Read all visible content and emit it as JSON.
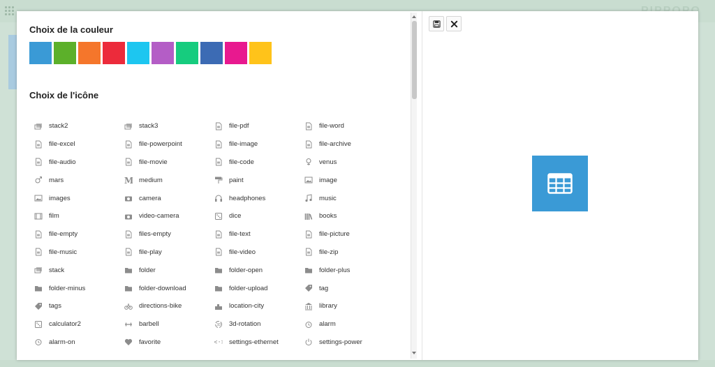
{
  "background": {
    "brand": "PIPPOPO"
  },
  "colors_section": {
    "title": "Choix de la couleur",
    "swatches": [
      "#3a9ad6",
      "#5cb02a",
      "#f5762b",
      "#ec2b3b",
      "#1dc6f0",
      "#b45dc6",
      "#16cc7e",
      "#3c6bb4",
      "#e8198f",
      "#ffc31a"
    ]
  },
  "icons_section": {
    "title": "Choix de l'icône",
    "rows": [
      [
        {
          "label": "stack2",
          "icon": "stack2-icon"
        },
        {
          "label": "stack3",
          "icon": "stack3-icon"
        },
        {
          "label": "file-pdf",
          "icon": "file-pdf-icon"
        },
        {
          "label": "file-word",
          "icon": "file-word-icon"
        }
      ],
      [
        {
          "label": "file-excel",
          "icon": "file-excel-icon"
        },
        {
          "label": "file-powerpoint",
          "icon": "file-powerpoint-icon"
        },
        {
          "label": "file-image",
          "icon": "file-image-icon"
        },
        {
          "label": "file-archive",
          "icon": "file-archive-icon"
        }
      ],
      [
        {
          "label": "file-audio",
          "icon": "file-audio-icon"
        },
        {
          "label": "file-movie",
          "icon": "file-movie-icon"
        },
        {
          "label": "file-code",
          "icon": "file-code-icon"
        },
        {
          "label": "venus",
          "icon": "venus-icon"
        }
      ],
      [
        {
          "label": "mars",
          "icon": "mars-icon"
        },
        {
          "label": "medium",
          "icon": "medium-icon"
        },
        {
          "label": "paint",
          "icon": "paint-icon"
        },
        {
          "label": "image",
          "icon": "image-icon"
        }
      ],
      [
        {
          "label": "images",
          "icon": "images-icon"
        },
        {
          "label": "camera",
          "icon": "camera-icon"
        },
        {
          "label": "headphones",
          "icon": "headphones-icon"
        },
        {
          "label": "music",
          "icon": "music-icon"
        }
      ],
      [
        {
          "label": "film",
          "icon": "film-icon"
        },
        {
          "label": "video-camera",
          "icon": "video-camera-icon"
        },
        {
          "label": "dice",
          "icon": "dice-icon"
        },
        {
          "label": "books",
          "icon": "books-icon"
        }
      ],
      [
        {
          "label": "file-empty",
          "icon": "file-empty-icon"
        },
        {
          "label": "files-empty",
          "icon": "files-empty-icon"
        },
        {
          "label": "file-text",
          "icon": "file-text-icon"
        },
        {
          "label": "file-picture",
          "icon": "file-picture-icon"
        }
      ],
      [
        {
          "label": "file-music",
          "icon": "file-music-icon"
        },
        {
          "label": "file-play",
          "icon": "file-play-icon"
        },
        {
          "label": "file-video",
          "icon": "file-video-icon"
        },
        {
          "label": "file-zip",
          "icon": "file-zip-icon"
        }
      ],
      [
        {
          "label": "stack",
          "icon": "stack-icon"
        },
        {
          "label": "folder",
          "icon": "folder-icon"
        },
        {
          "label": "folder-open",
          "icon": "folder-open-icon"
        },
        {
          "label": "folder-plus",
          "icon": "folder-plus-icon"
        }
      ],
      [
        {
          "label": "folder-minus",
          "icon": "folder-minus-icon"
        },
        {
          "label": "folder-download",
          "icon": "folder-download-icon"
        },
        {
          "label": "folder-upload",
          "icon": "folder-upload-icon"
        },
        {
          "label": "tag",
          "icon": "tag-icon"
        }
      ],
      [
        {
          "label": "tags",
          "icon": "tags-icon"
        },
        {
          "label": "directions-bike",
          "icon": "directions-bike-icon"
        },
        {
          "label": "location-city",
          "icon": "location-city-icon"
        },
        {
          "label": "library",
          "icon": "library-icon"
        }
      ],
      [
        {
          "label": "calculator2",
          "icon": "calculator2-icon"
        },
        {
          "label": "barbell",
          "icon": "barbell-icon"
        },
        {
          "label": "3d-rotation",
          "icon": "3d-rotation-icon"
        },
        {
          "label": "alarm",
          "icon": "alarm-icon"
        }
      ],
      [
        {
          "label": "alarm-on",
          "icon": "alarm-on-icon"
        },
        {
          "label": "favorite",
          "icon": "favorite-icon"
        },
        {
          "label": "settings-ethernet",
          "icon": "settings-ethernet-icon"
        },
        {
          "label": "settings-power",
          "icon": "settings-power-icon"
        }
      ]
    ]
  },
  "toolbar": {
    "save_icon": "floppy-disk-icon",
    "close_icon": "close-icon"
  },
  "preview": {
    "color": "#3a9ad6",
    "icon": "table-icon"
  }
}
